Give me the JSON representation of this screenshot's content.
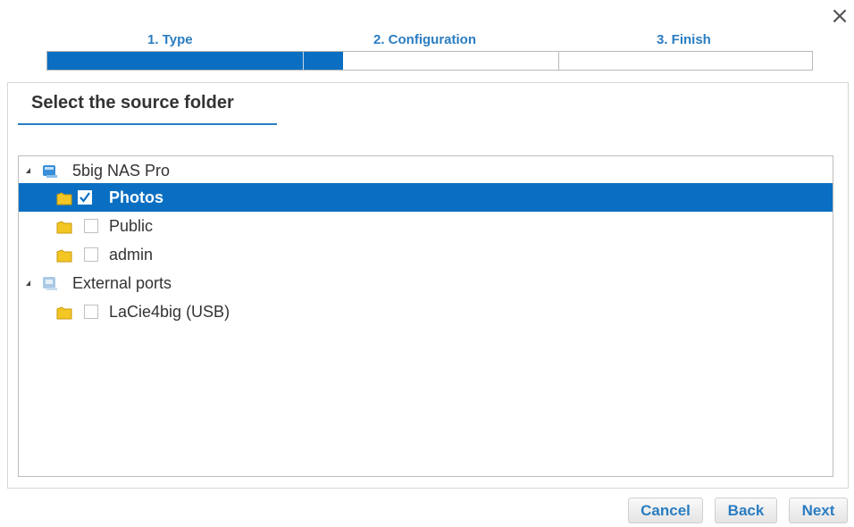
{
  "dialog": {
    "close_glyph": "×"
  },
  "wizard": {
    "steps": [
      {
        "label": "1. Type"
      },
      {
        "label": "2. Configuration"
      },
      {
        "label": "3. Finish"
      }
    ],
    "progress_fraction": 0.387
  },
  "panel": {
    "title": "Select the source folder"
  },
  "tree": {
    "nodes": [
      {
        "label": "5big NAS Pro",
        "type": "device",
        "icon": "nas-icon",
        "expanded": true
      },
      {
        "label": "Photos",
        "type": "folder",
        "icon": "folder-icon",
        "checked": true,
        "selected": true
      },
      {
        "label": "Public",
        "type": "folder",
        "icon": "folder-icon",
        "checked": false,
        "selected": false
      },
      {
        "label": "admin",
        "type": "folder",
        "icon": "folder-icon",
        "checked": false,
        "selected": false
      },
      {
        "label": "External ports",
        "type": "device",
        "icon": "external-ports-icon",
        "expanded": true
      },
      {
        "label": "LaCie4big (USB)",
        "type": "folder",
        "icon": "folder-icon",
        "checked": false,
        "selected": false
      }
    ]
  },
  "buttons": {
    "cancel": "Cancel",
    "back": "Back",
    "next": "Next"
  },
  "colors": {
    "accent": "#0a6fc2",
    "step_text": "#2a7dc1"
  }
}
